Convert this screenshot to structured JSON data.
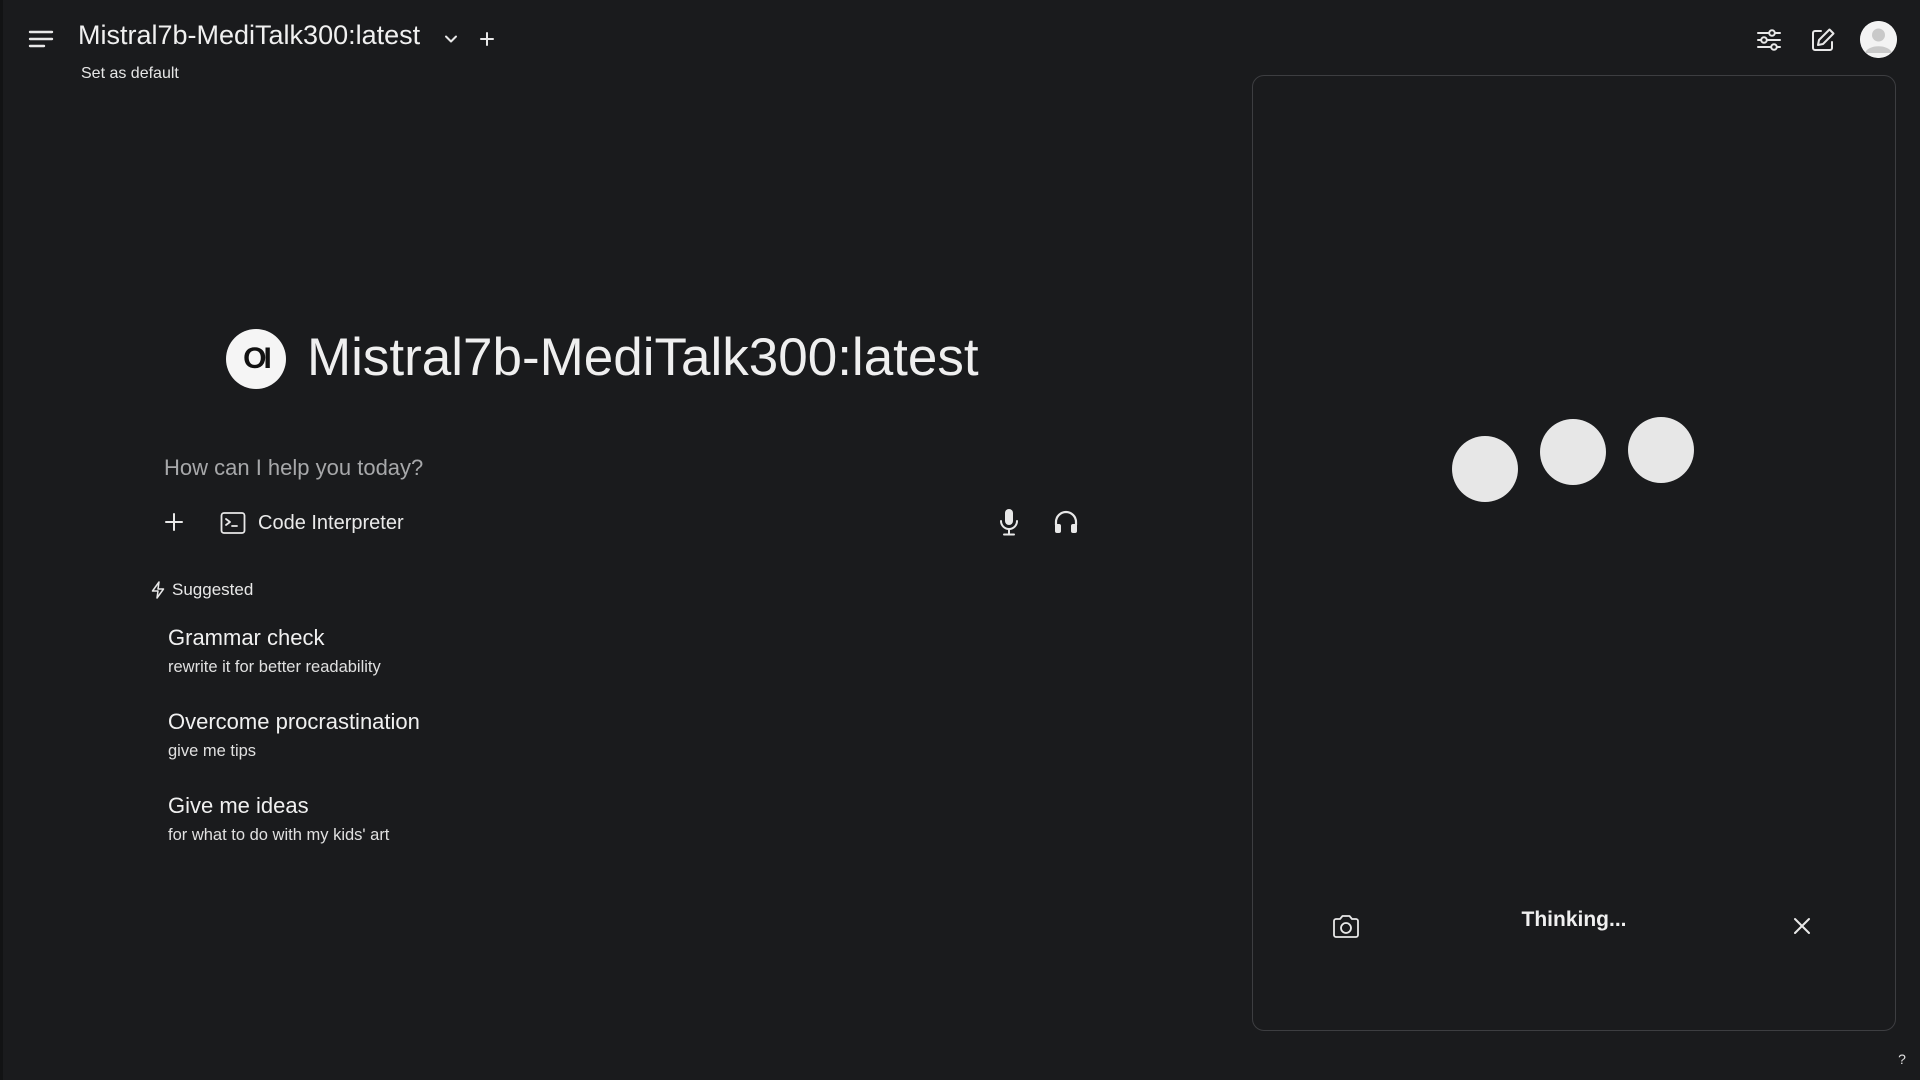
{
  "header": {
    "model_name": "Mistral7b-MediTalk300:latest",
    "set_default_label": "Set as default",
    "icons": {
      "menu": "hamburger-menu-icon",
      "chevron": "chevron-down-icon",
      "add_model": "plus-icon",
      "controls": "sliders-icon",
      "new_chat": "pencil-square-icon",
      "avatar": "user-avatar"
    }
  },
  "hero": {
    "logo_text": "OI",
    "title": "Mistral7b-MediTalk300:latest"
  },
  "input": {
    "placeholder": "How can I help you today?",
    "value": "",
    "code_interpreter_label": "Code Interpreter"
  },
  "suggested": {
    "label": "Suggested",
    "items": [
      {
        "title": "Grammar check",
        "subtitle": "rewrite it for better readability"
      },
      {
        "title": "Overcome procrastination",
        "subtitle": "give me tips"
      },
      {
        "title": "Give me ideas",
        "subtitle": "for what to do with my kids' art"
      }
    ]
  },
  "call": {
    "status": "Thinking...",
    "icons": {
      "camera": "camera-icon",
      "close": "close-icon"
    }
  },
  "help_label": "?",
  "colors": {
    "background": "#1a1b1d",
    "text": "#ececec",
    "muted_text": "#a7a8aa",
    "panel_border": "#3d3e41",
    "dot": "#e7e7e7"
  }
}
